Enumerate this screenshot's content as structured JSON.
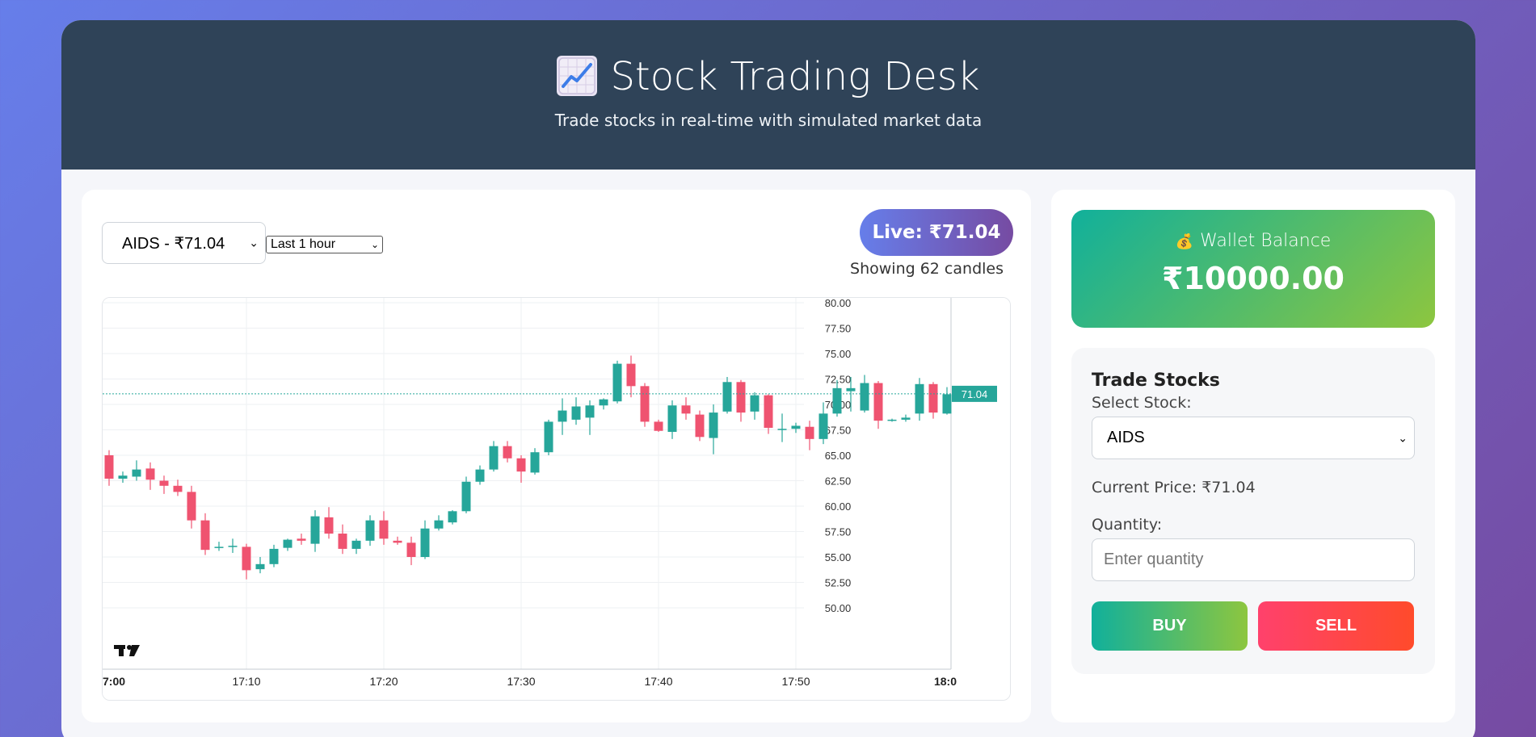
{
  "header": {
    "emoji": "📈",
    "title": "Stock Trading Desk",
    "subtitle": "Trade stocks in real-time with simulated market data"
  },
  "chart_controls": {
    "stock_select": "AIDS - ₹71.04",
    "range_select": "Last 1 hour",
    "live_badge": "Live: ₹71.04",
    "candle_count": "Showing 62 candles"
  },
  "wallet": {
    "icon": "money-bag-icon",
    "label": "Wallet Balance",
    "amount": "₹10000.00"
  },
  "trade": {
    "title": "Trade Stocks",
    "select_label": "Select Stock:",
    "select_value": "AIDS",
    "current_price": "Current Price: ₹71.04",
    "qty_label": "Quantity:",
    "qty_placeholder": "Enter quantity",
    "buy_label": "BUY",
    "sell_label": "SELL"
  },
  "colors": {
    "up": "#26a69a",
    "down": "#ef5370",
    "header_bg": "#2f4358",
    "accent": "#667eea"
  },
  "chart_data": {
    "type": "candlestick",
    "x_ticks": [
      "7:00",
      "17:10",
      "17:20",
      "17:30",
      "17:40",
      "17:50",
      "18:0"
    ],
    "y_ticks": [
      "80.00",
      "77.50",
      "75.00",
      "72.50",
      "70.00",
      "67.50",
      "65.00",
      "62.50",
      "60.00",
      "57.50",
      "55.00",
      "52.50",
      "50.00"
    ],
    "ylim": [
      50,
      80
    ],
    "last_price": "71.04",
    "candles": [
      [
        65.0,
        65.5,
        62.0,
        62.7
      ],
      [
        62.7,
        63.4,
        62.3,
        63.0
      ],
      [
        62.9,
        64.5,
        62.5,
        63.6
      ],
      [
        63.7,
        64.3,
        61.6,
        62.6
      ],
      [
        62.5,
        63.0,
        61.2,
        62.0
      ],
      [
        62.0,
        62.6,
        61.0,
        61.4
      ],
      [
        61.4,
        62.0,
        57.8,
        58.6
      ],
      [
        58.6,
        59.3,
        55.2,
        55.7
      ],
      [
        55.9,
        56.5,
        55.6,
        56.0
      ],
      [
        56.0,
        56.8,
        55.4,
        56.1
      ],
      [
        56.0,
        56.3,
        52.8,
        53.7
      ],
      [
        53.8,
        55.0,
        53.4,
        54.3
      ],
      [
        54.3,
        56.2,
        54.0,
        55.8
      ],
      [
        55.9,
        56.8,
        55.6,
        56.7
      ],
      [
        56.8,
        57.3,
        56.2,
        56.6
      ],
      [
        56.3,
        59.6,
        55.5,
        59.0
      ],
      [
        58.9,
        59.9,
        56.8,
        57.3
      ],
      [
        57.3,
        58.2,
        55.3,
        55.8
      ],
      [
        55.8,
        56.8,
        55.3,
        56.6
      ],
      [
        56.6,
        59.1,
        56.1,
        58.6
      ],
      [
        58.6,
        59.5,
        56.2,
        56.8
      ],
      [
        56.6,
        57.0,
        56.2,
        56.4
      ],
      [
        56.4,
        57.0,
        54.2,
        55.0
      ],
      [
        55.0,
        58.6,
        54.8,
        57.8
      ],
      [
        57.8,
        59.1,
        57.6,
        58.6
      ],
      [
        58.4,
        59.6,
        58.2,
        59.5
      ],
      [
        59.5,
        62.9,
        59.3,
        62.4
      ],
      [
        62.4,
        64.0,
        62.1,
        63.6
      ],
      [
        63.6,
        66.4,
        63.4,
        65.9
      ],
      [
        65.9,
        66.4,
        64.3,
        64.7
      ],
      [
        64.7,
        65.0,
        62.3,
        63.4
      ],
      [
        63.3,
        65.7,
        63.1,
        65.3
      ],
      [
        65.3,
        68.5,
        65.0,
        68.3
      ],
      [
        68.3,
        70.6,
        67.0,
        69.4
      ],
      [
        68.5,
        70.7,
        68.0,
        69.8
      ],
      [
        68.7,
        70.4,
        67.0,
        69.9
      ],
      [
        69.9,
        70.6,
        69.5,
        70.5
      ],
      [
        70.3,
        74.3,
        70.1,
        74.0
      ],
      [
        74.0,
        74.8,
        70.7,
        71.8
      ],
      [
        71.8,
        72.1,
        67.8,
        68.3
      ],
      [
        68.3,
        68.5,
        67.3,
        67.4
      ],
      [
        67.3,
        70.4,
        66.6,
        69.9
      ],
      [
        69.9,
        70.7,
        68.5,
        69.1
      ],
      [
        69.0,
        69.4,
        66.4,
        66.8
      ],
      [
        66.7,
        70.0,
        65.1,
        69.2
      ],
      [
        69.3,
        72.7,
        69.1,
        72.2
      ],
      [
        72.2,
        72.4,
        68.3,
        69.2
      ],
      [
        69.3,
        71.2,
        68.5,
        70.9
      ],
      [
        70.9,
        71.0,
        67.1,
        67.7
      ],
      [
        67.6,
        69.1,
        66.3,
        67.6
      ],
      [
        67.6,
        68.2,
        67.2,
        67.9
      ],
      [
        67.8,
        68.4,
        65.5,
        66.6
      ],
      [
        66.6,
        70.2,
        66.1,
        69.1
      ],
      [
        69.1,
        72.4,
        68.8,
        71.6
      ],
      [
        71.3,
        72.7,
        69.3,
        71.6
      ],
      [
        69.4,
        72.9,
        69.2,
        72.1
      ],
      [
        72.1,
        72.3,
        67.6,
        68.4
      ],
      [
        68.4,
        68.6,
        68.3,
        68.5
      ],
      [
        68.5,
        69.0,
        68.3,
        68.7
      ],
      [
        69.1,
        72.6,
        68.4,
        72.0
      ],
      [
        72.0,
        72.2,
        68.6,
        69.2
      ],
      [
        69.1,
        71.7,
        69.0,
        71.0
      ]
    ]
  }
}
